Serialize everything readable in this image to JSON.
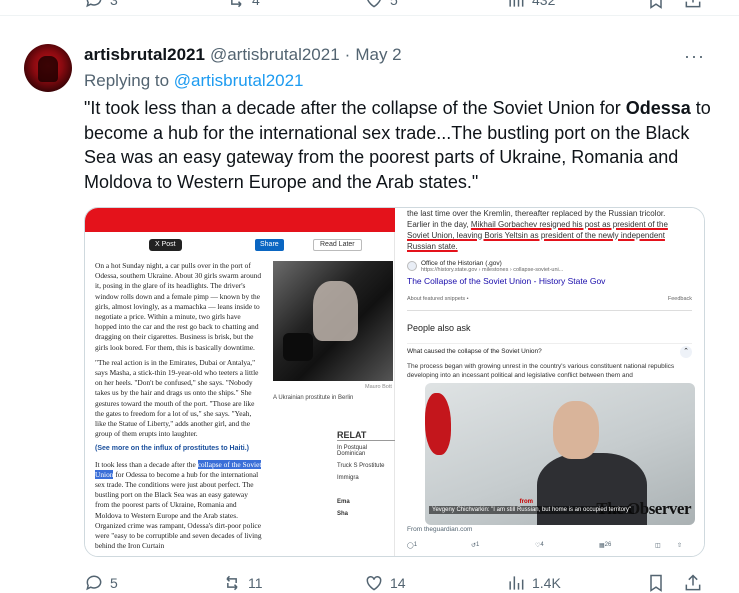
{
  "top_actions": {
    "replies": "3",
    "reposts": "4",
    "likes": "5",
    "views": "432"
  },
  "tweet": {
    "display_name": "artisbrutal2021",
    "handle": "@artisbrutal2021",
    "separator": "·",
    "date": "May 2",
    "more": "···",
    "replying_to_label": "Replying to",
    "replying_to_handle": "@artisbrutal2021",
    "text_before": "\"It took less than a decade after the collapse of the Soviet Union for ",
    "text_bold": "Odessa",
    "text_after": " to become a hub for the international sex trade...The bustling port on the Black Sea was an easy  gateway from the poorest parts of Ukraine, Romania and Moldova to  Western Europe and the Arab states.\""
  },
  "media_left": {
    "share_x": "X Post",
    "share_in": "Share",
    "read_later": "Read Later",
    "para1": "On a hot Sunday night, a car pulls over in the port of Odessa, southern Ukraine. About 30 girls swarm around it, posing in the glare of its headlights. The driver's window rolls down and a female pimp — known by the girls, almost lovingly, as a mamachka — leans inside to negotiate a price. Within a minute, two girls have hopped into the car and the rest go back to chatting and dragging on their cigarettes. Business is brisk, but the girls look bored. For them, this is basically downtime.",
    "para2": "\"The real action is in the Emirates, Dubai or Antalya,\" says Masha, a stick-thin 19-year-old who teeters a little on her heels. \"Don't be confused,\" she says. \"Nobody takes us by the hair and drags us onto the ships.\" She gestures toward the mouth of the port. \"Those are like the gates to freedom for a lot of us,\" she says. \"Yeah, like the Statue of Liberty,\" adds another girl, and the group of them erupts into laughter.",
    "more_link": "(See more on the influx of prostitutes to Haiti.)",
    "para3_before": "It took less than a decade after the ",
    "para3_highlight": "collapse of the Soviet Union",
    "para3_after": " for Odessa to become a hub for the international sex trade. The conditions were just about perfect. The bustling port on the Black Sea was an easy gateway from the poorest parts of Ukraine, Romania and Moldova to Western Europe and the Arab states. Organized crime was rampant, Odessa's dirt-poor police were \"easy to be corruptible and seven decades of living behind the Iron Curtain",
    "photo_caption": "A Ukrainian prostitute in Berlin",
    "photo_credit": "Mauro Bott",
    "related_title": "RELAT",
    "related_items": [
      "In Postqual Dominican",
      "Truck S Prostitute",
      "Immigra"
    ],
    "related_tail": [
      "Ema",
      "Sha"
    ]
  },
  "media_right": {
    "snippet_pre": "the last time over the Kremlin, thereafter replaced by the Russian tricolor. Earlier in the day, ",
    "snippet_ul": "Mikhail Gorbachev resigned his post as president of the Soviet Union, leaving Boris Yeltsin as president of the newly independent Russian state.",
    "source_name": "Office of the Historian (.gov)",
    "source_url": "https://history.state.gov › milestones › collapse-soviet-uni...",
    "source_title": "The Collapse of the Soviet Union - History State Gov",
    "about_snippets": "About featured snippets  •",
    "feedback": "Feedback",
    "paa_title": "People also ask",
    "question": "What caused the collapse of the Soviet Union?",
    "answer": "The process began with growing unrest in the country's various constituent national republics developing into an incessant political and legislative conflict between them and",
    "guardian_caption": "Yevgeny Chichvarkin: \"I am still Russian, but home is an occupied territory\"",
    "guardian_from": "from",
    "observer": "The Observer",
    "guardian_source": "From theguardian.com",
    "g_replies": "1",
    "g_reposts": "1",
    "g_likes": "4",
    "g_views": "26"
  },
  "bottom_actions": {
    "replies": "5",
    "reposts": "11",
    "likes": "14",
    "views": "1.4K"
  },
  "colors": {
    "accent": "#1d9bf0",
    "muted": "#536471",
    "text": "#0f1419"
  }
}
